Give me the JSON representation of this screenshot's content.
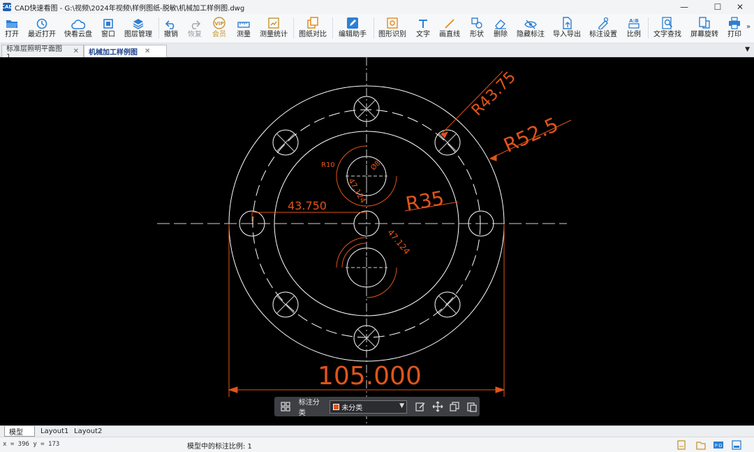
{
  "window": {
    "title": "CAD快速看图 - G:\\视频\\2024年视频\\样例图纸-脱敏\\机械加工样例图.dwg",
    "logo_text": "CAD",
    "min_glyph": "—",
    "max_glyph": "☐",
    "close_glyph": "✕"
  },
  "toolbar": [
    {
      "key": "open",
      "label": "打开",
      "icon": "folder-open-icon",
      "color": "#2d7fd3"
    },
    {
      "key": "recent",
      "label": "最近打开",
      "icon": "clock-icon",
      "color": "#2d7fd3"
    },
    {
      "key": "cloud",
      "label": "快看云盘",
      "icon": "cloud-icon",
      "color": "#2d7fd3"
    },
    {
      "key": "window",
      "label": "窗口",
      "icon": "window-icon",
      "color": "#2d7fd3"
    },
    {
      "key": "layers",
      "label": "图层管理",
      "icon": "layers-icon",
      "color": "#2d7fd3"
    },
    {
      "key": "undo",
      "label": "撤销",
      "icon": "undo-icon",
      "color": "#2d7fd3"
    },
    {
      "key": "redo",
      "label": "恢复",
      "icon": "redo-icon",
      "color": "#aaaaaa"
    },
    {
      "key": "vip",
      "label": "会员",
      "icon": "vip-icon",
      "color": "#c8952a"
    },
    {
      "key": "measure",
      "label": "测量",
      "icon": "ruler-icon",
      "color": "#2d7fd3"
    },
    {
      "key": "measure_stats",
      "label": "测量统计",
      "icon": "measure-stats-icon",
      "color": "#c8952a"
    },
    {
      "key": "compare",
      "label": "图纸对比",
      "icon": "compare-icon",
      "color": "#e48a1c"
    },
    {
      "key": "edit_helper",
      "label": "编辑助手",
      "icon": "edit-helper-icon",
      "color": "#2d7fd3"
    },
    {
      "key": "shape_recog",
      "label": "图形识别",
      "icon": "shape-recognition-icon",
      "color": "#e48a1c"
    },
    {
      "key": "text",
      "label": "文字",
      "icon": "text-icon",
      "color": "#2d7fd3"
    },
    {
      "key": "line",
      "label": "画直线",
      "icon": "line-icon",
      "color": "#e48a1c"
    },
    {
      "key": "shape",
      "label": "形状",
      "icon": "shape-icon",
      "color": "#2d7fd3"
    },
    {
      "key": "delete",
      "label": "删除",
      "icon": "eraser-icon",
      "color": "#2d7fd3"
    },
    {
      "key": "hide_dim",
      "label": "隐藏标注",
      "icon": "eye-hide-icon",
      "color": "#2d7fd3"
    },
    {
      "key": "import_export",
      "label": "导入导出",
      "icon": "import-export-icon",
      "color": "#2d7fd3"
    },
    {
      "key": "dim_settings",
      "label": "标注设置",
      "icon": "dim-settings-icon",
      "color": "#2d7fd3"
    },
    {
      "key": "ratio",
      "label": "比例",
      "icon": "ratio-icon",
      "color": "#2d7fd3"
    },
    {
      "key": "text_search",
      "label": "文字查找",
      "icon": "text-search-icon",
      "color": "#2d7fd3"
    },
    {
      "key": "rotate",
      "label": "屏幕旋转",
      "icon": "rotate-screen-icon",
      "color": "#2d7fd3"
    },
    {
      "key": "print",
      "label": "打印",
      "icon": "print-icon",
      "color": "#2d7fd3"
    }
  ],
  "toolbar_more": "»",
  "tabs": [
    {
      "label": "标准层照明平面图1",
      "close": "✕",
      "active": false
    },
    {
      "label": "机械加工样例图",
      "close": "✕",
      "active": true
    }
  ],
  "tab_menu_glyph": "▼",
  "drawing": {
    "dim_color": "#e0541a",
    "line_color": "#ffffff",
    "labels": {
      "r43": "R43.75",
      "r52": "R52.5",
      "r35": "R35",
      "h43": "43.750",
      "w105": "105.000",
      "r10": "R10",
      "d8": "Ø8",
      "a1": "47.124",
      "a2": "47.124"
    }
  },
  "floatbar": {
    "category_label": "标注分类",
    "select_value": "未分类",
    "swatch_color": "#e0541a",
    "caret": "▼"
  },
  "layouts": [
    {
      "label": "模型",
      "active": true
    },
    {
      "label": "Layout1",
      "active": false
    },
    {
      "label": "Layout2",
      "active": false
    }
  ],
  "status": {
    "coords": "x = 396  y = 173",
    "scale_text": "模型中的标注比例: 1"
  }
}
